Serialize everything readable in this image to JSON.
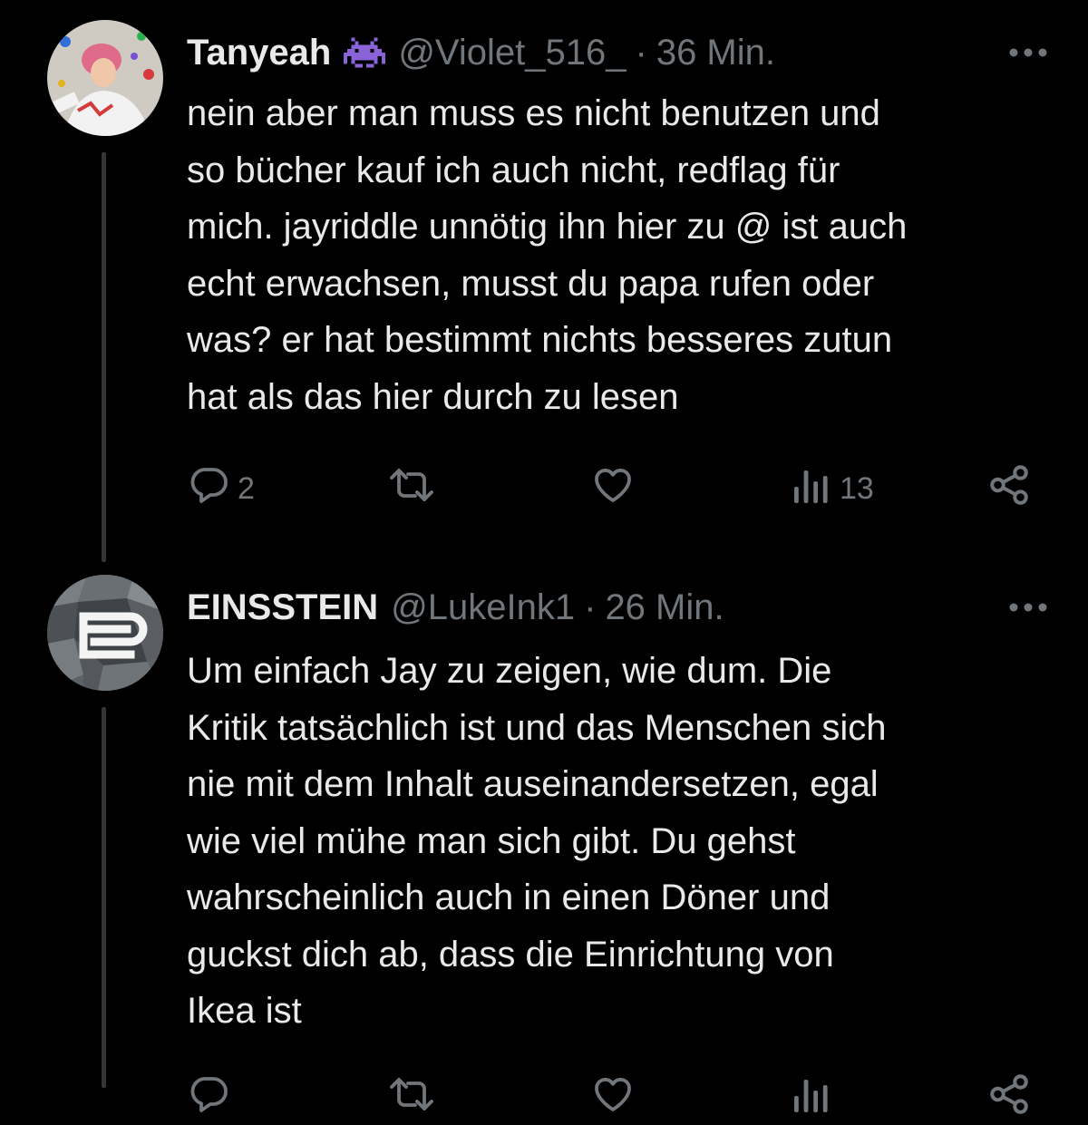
{
  "tweets": [
    {
      "author_name": "Tanyeah",
      "badge_icon": "space-invader-icon",
      "handle": "@Violet_516_",
      "separator": "·",
      "time": "36 Min.",
      "more_icon": "more-icon",
      "text": "nein aber man muss es nicht benutzen und\nso bücher kauf ich auch nicht, redflag für\nmich. jayriddle unnötig ihn hier zu @ ist auch\necht erwachsen, musst du papa rufen oder\nwas? er hat bestimmt nichts besseres zutun\nhat als das hier durch zu lesen",
      "reply_count": "2",
      "retweet_count": "",
      "like_count": "",
      "view_count": "13"
    },
    {
      "author_name": "EINSSTEIN",
      "handle": "@LukeInk1",
      "separator": "·",
      "time": "26 Min.",
      "more_icon": "more-icon",
      "text": "Um einfach Jay zu zeigen, wie dum. Die\nKritik tatsächlich ist und das Menschen sich\nnie mit dem Inhalt auseinandersetzen, egal\nwie viel mühe man sich gibt. Du gehst\nwahrscheinlich auch in einen Döner und\nguckst dich ab, dass die Einrichtung von\nIkea ist"
    }
  ],
  "colors": {
    "background": "#000000",
    "text_primary": "#e7e9ea",
    "text_secondary": "#71767b",
    "thread_line": "#333639",
    "badge": "#8b63d9"
  }
}
